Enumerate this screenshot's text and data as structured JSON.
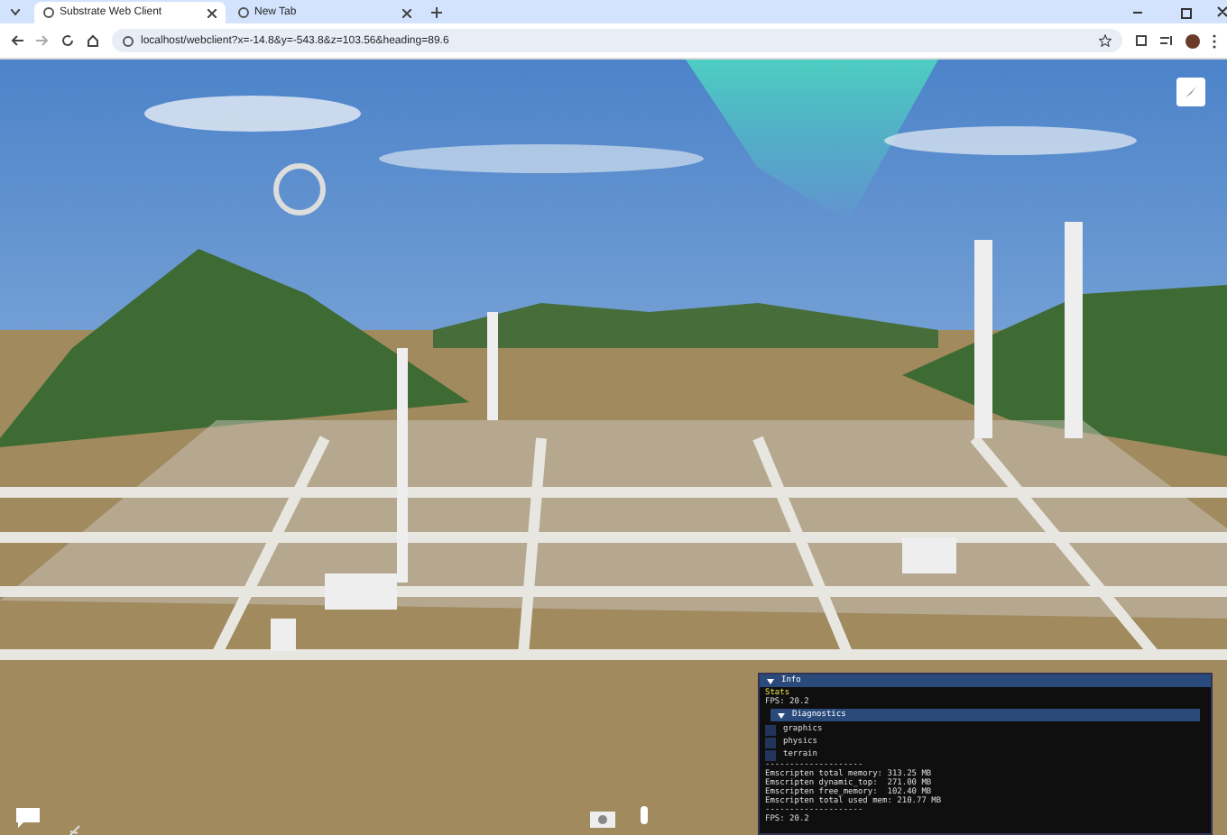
{
  "tabs": [
    {
      "title": "Substrate Web Client",
      "selected": true
    },
    {
      "title": "New Tab",
      "selected": false
    }
  ],
  "address": "localhost/webclient?x=-14.8&y=-543.8&z=103.56&heading=89.6",
  "info_panel": {
    "title": "Info",
    "expanded": true,
    "stats_label": "Stats",
    "fps": "FPS: 20.2",
    "diagnostics": {
      "title": "Diagnostics",
      "expanded": true,
      "options": [
        {
          "label": "graphics",
          "checked": false
        },
        {
          "label": "physics",
          "checked": false
        },
        {
          "label": "terrain",
          "checked": false
        }
      ]
    },
    "separator": "--------------------",
    "memory_lines": [
      "Emscripten total memory: 313.25 MB",
      "Emscripten dynamic_top:  271.00 MB",
      "Emscripten free_memory:  102.40 MB",
      "Emscripten total used mem: 210.77 MB"
    ],
    "separator_2": "--------------------",
    "fps_2": "FPS: 20.2"
  }
}
